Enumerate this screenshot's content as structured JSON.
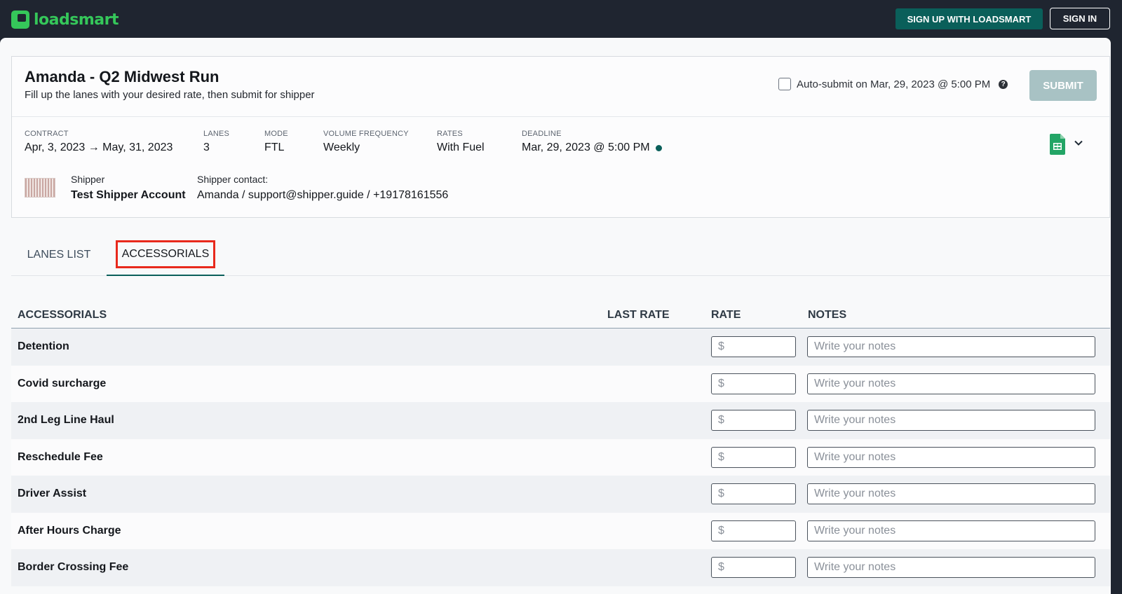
{
  "header": {
    "brand": "loadsmart",
    "signup_label": "SIGN UP WITH LOADSMART",
    "signin_label": "SIGN IN"
  },
  "bid": {
    "title": "Amanda - Q2 Midwest Run",
    "subtitle": "Fill up the lanes with your desired rate, then submit for shipper",
    "auto_submit_label": "Auto-submit on Mar, 29, 2023 @ 5:00 PM",
    "submit_label": "SUBMIT"
  },
  "stats": {
    "contract": {
      "label": "CONTRACT",
      "value": "Apr, 3, 2023 → May, 31, 2023"
    },
    "lanes": {
      "label": "LANES",
      "value": "3"
    },
    "mode": {
      "label": "MODE",
      "value": "FTL"
    },
    "volume": {
      "label": "VOLUME FREQUENCY",
      "value": "Weekly"
    },
    "rates": {
      "label": "RATES",
      "value": "With Fuel"
    },
    "deadline": {
      "label": "DEADLINE",
      "value": "Mar, 29, 2023 @ 5:00 PM"
    }
  },
  "shipper": {
    "label": "Shipper",
    "name": "Test Shipper Account",
    "contact_label": "Shipper contact:",
    "contact_value": "Amanda / support@shipper.guide / +19178161556"
  },
  "tabs": {
    "lanes_list": "LANES LIST",
    "accessorials": "ACCESSORIALS"
  },
  "table": {
    "columns": {
      "accessorials": "ACCESSORIALS",
      "last_rate": "LAST RATE",
      "rate": "RATE",
      "notes": "NOTES"
    },
    "rate_placeholder": "$",
    "notes_placeholder": "Write your notes",
    "rows": [
      "Detention",
      "Covid surcharge",
      "2nd Leg Line Haul",
      "Reschedule Fee",
      "Driver Assist",
      "After Hours Charge",
      "Border Crossing Fee"
    ]
  },
  "colors": {
    "brand_green": "#35c75a",
    "primary_teal": "#0a5f5a",
    "highlight_red": "#e8291c",
    "submit_disabled": "#a8c2c4"
  },
  "icons": {
    "sheets": "google-sheets-icon",
    "chevron": "chevron-down-icon",
    "help": "help-icon"
  }
}
